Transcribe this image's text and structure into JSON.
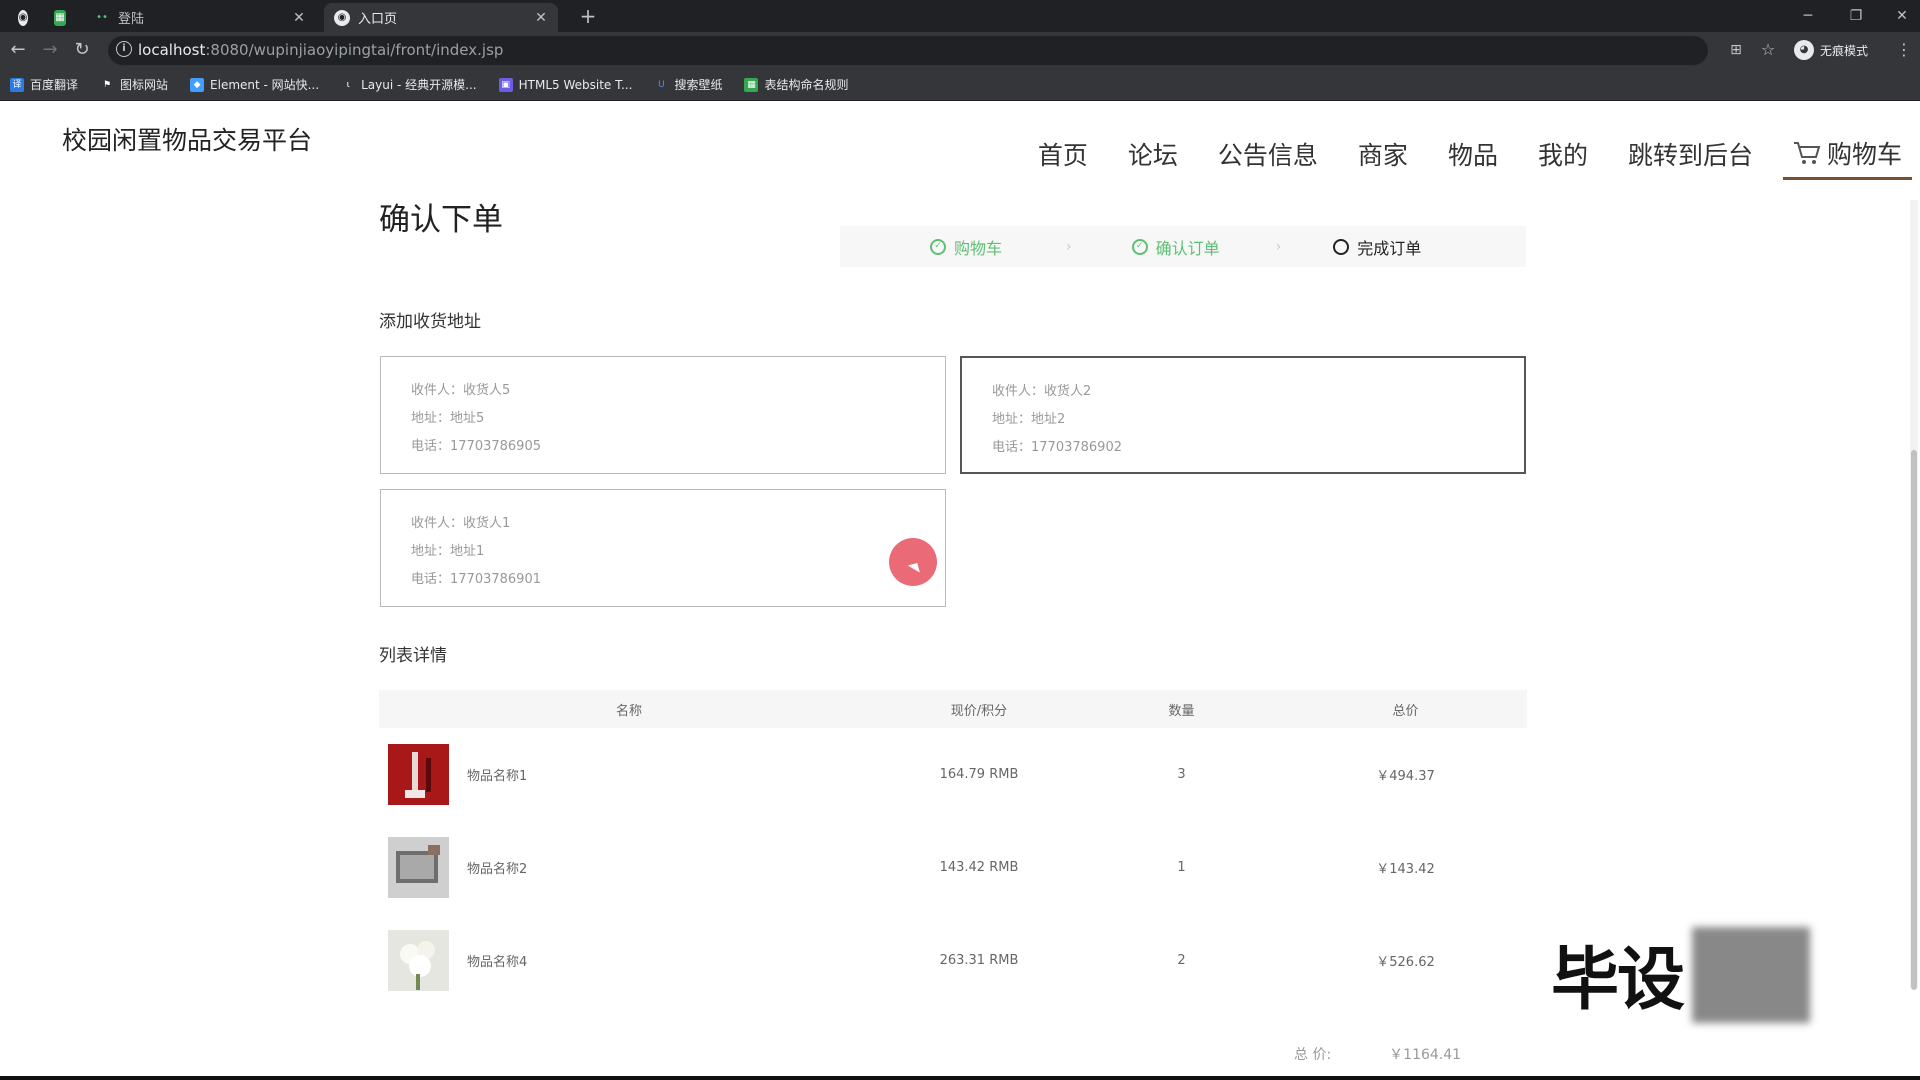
{
  "browser": {
    "tabs": [
      {
        "label": "",
        "active": false
      },
      {
        "label": "登陆",
        "active": false
      },
      {
        "label": "入口页",
        "active": true
      }
    ],
    "url_host": "localhost",
    "url_path": ":8080/wupinjiaoyipingtai/front/index.jsp",
    "incognito_label": "无痕模式",
    "bookmarks": [
      "百度翻译",
      "图标网站",
      "Element - 网站快...",
      "Layui - 经典开源模...",
      "HTML5 Website T...",
      "搜索壁纸",
      "表结构命名规则"
    ]
  },
  "site": {
    "title": "校园闲置物品交易平台",
    "nav": [
      "首页",
      "论坛",
      "公告信息",
      "商家",
      "物品",
      "我的",
      "跳转到后台"
    ],
    "cart_label": "购物车"
  },
  "order": {
    "heading": "确认下单",
    "steps": [
      "购物车",
      "确认订单",
      "完成订单"
    ],
    "address_section": "添加收货地址",
    "addresses": [
      {
        "recipient": "收件人：收货人5",
        "address": "地址：地址5",
        "phone": "电话：17703786905"
      },
      {
        "recipient": "收件人：收货人2",
        "address": "地址：地址2",
        "phone": "电话：17703786902"
      },
      {
        "recipient": "收件人：收货人1",
        "address": "地址：地址1",
        "phone": "电话：17703786901"
      }
    ],
    "list_section": "列表详情",
    "columns": [
      "名称",
      "现价/积分",
      "数量",
      "总价"
    ],
    "items": [
      {
        "name": "物品名称1",
        "price": "164.79 RMB",
        "qty": "3",
        "total": "￥494.37"
      },
      {
        "name": "物品名称2",
        "price": "143.42 RMB",
        "qty": "1",
        "total": "￥143.42"
      },
      {
        "name": "物品名称4",
        "price": "263.31 RMB",
        "qty": "2",
        "total": "￥526.62"
      }
    ],
    "total_label": "总 价:",
    "total_value": "￥1164.41"
  },
  "watermark": "毕设"
}
